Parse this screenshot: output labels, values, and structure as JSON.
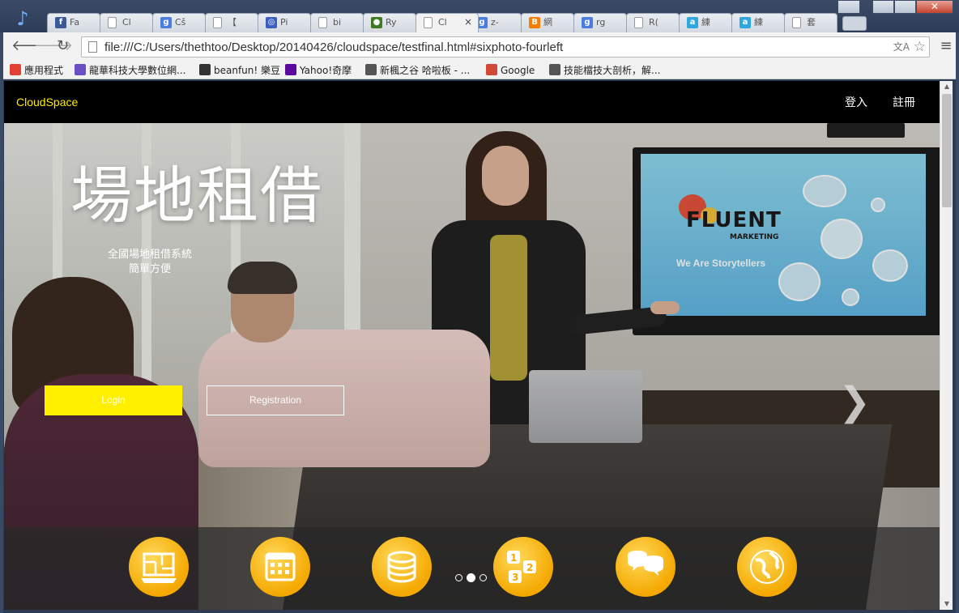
{
  "browser": {
    "tabs": [
      {
        "label": "Fa",
        "fav": "f",
        "fav_color": "#3b5998"
      },
      {
        "label": "Cl",
        "fav": "",
        "fav_color": "#ffffff"
      },
      {
        "label": "Cš",
        "fav": "g",
        "fav_color": "#4a7de0"
      },
      {
        "label": "【",
        "fav": "",
        "fav_color": "#ffffff"
      },
      {
        "label": "Pi",
        "fav": "◎",
        "fav_color": "#3a5fbf"
      },
      {
        "label": "bi",
        "fav": "",
        "fav_color": "#ffffff"
      },
      {
        "label": "Ry",
        "fav": "●",
        "fav_color": "#3d7a22"
      },
      {
        "label": "Cl",
        "fav": "",
        "fav_color": "#ffffff",
        "active": true
      },
      {
        "label": "z-",
        "fav": "g",
        "fav_color": "#4a7de0"
      },
      {
        "label": "網",
        "fav": "B",
        "fav_color": "#f57d00"
      },
      {
        "label": "rg",
        "fav": "g",
        "fav_color": "#4a7de0"
      },
      {
        "label": "R(",
        "fav": "",
        "fav_color": "#ffffff"
      },
      {
        "label": "練",
        "fav": "a",
        "fav_color": "#2ea7e0"
      },
      {
        "label": "練",
        "fav": "a",
        "fav_color": "#2ea7e0"
      },
      {
        "label": "套",
        "fav": "",
        "fav_color": "#ffffff"
      }
    ],
    "active_tab_close": "×",
    "url": "file:///C:/Users/thethtoo/Desktop/20140426/cloudspace/testfinal.html#sixphoto-fourleft",
    "bookmarks": [
      {
        "label": "應用程式",
        "icon": "apps-icon",
        "color": "#e34133"
      },
      {
        "label": "龍華科技大學數位網...",
        "icon": "school-icon",
        "color": "#6a4fc4"
      },
      {
        "label": "beanfun! 樂豆",
        "icon": "beanfun-icon",
        "color": "#333333"
      },
      {
        "label": "Yahoo!奇摩",
        "icon": "yahoo-icon",
        "color": "#5c0a9e"
      },
      {
        "label": "新楓之谷 哈啦板 - ...",
        "icon": "forum-icon",
        "color": "#555555"
      },
      {
        "label": "Google",
        "icon": "google-plus-icon",
        "color": "#d14836"
      },
      {
        "label": "技能檔技大剖析，解...",
        "icon": "forum-icon",
        "color": "#555555"
      }
    ]
  },
  "site": {
    "brand": "CloudSpace",
    "nav_login": "登入",
    "nav_register": "註冊",
    "hero_title": "場地租借",
    "hero_sub_1": "全國場地租借系統",
    "hero_sub_2": "簡單方便",
    "login_btn": "Login",
    "register_btn": "Registration",
    "next_arrow": "❯",
    "screen_logo": "FLUENT",
    "screen_logo_sub": "MARKETING",
    "screen_tagline": "We Are Storytellers",
    "features": [
      "floorplan-icon",
      "calendar-icon",
      "coins-icon",
      "numbered-steps-icon",
      "chat-bubbles-icon",
      "globe-icon"
    ],
    "carousel_dots": 3,
    "carousel_active": 2,
    "accent": "#fff000",
    "feature_color": "#f7b500"
  }
}
